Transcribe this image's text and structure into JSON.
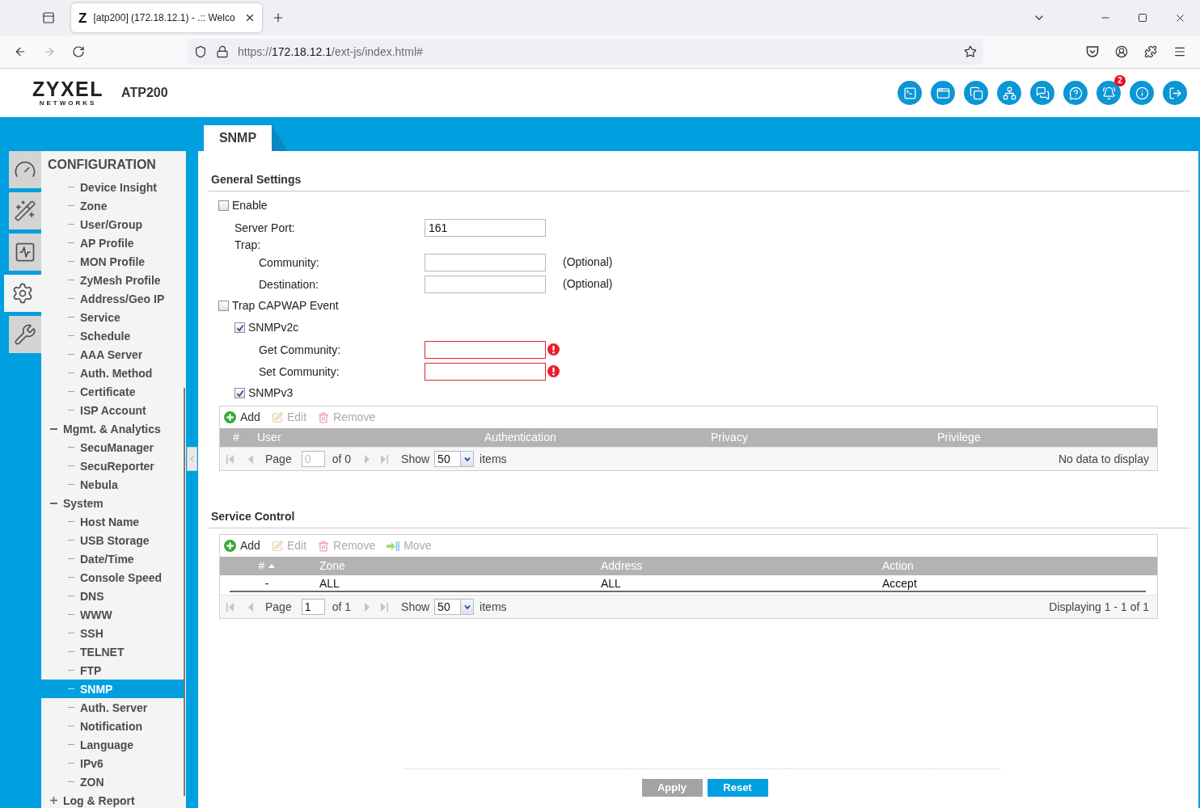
{
  "browser": {
    "tabs": [
      {
        "favicon": "Z",
        "title": "[atp200] (172.18.12.1) - .:: Welco",
        "selected": true
      }
    ],
    "address": {
      "scheme": "https://",
      "host": "172.18.12.1",
      "path": "/ext-js/index.html#"
    }
  },
  "header": {
    "logo": {
      "word": "ZYXEL",
      "tagline": "NETWORKS"
    },
    "product": "ATP200",
    "notification_count": "2"
  },
  "rail_tabs": [
    {
      "selected": false
    },
    {
      "selected": false
    },
    {
      "selected": false
    },
    {
      "selected": true
    },
    {
      "selected": false
    }
  ],
  "sidebar": {
    "title": "CONFIGURATION",
    "items": [
      {
        "children": [
          {
            "label": "Device Insight",
            "selected": false
          },
          {
            "label": "Zone",
            "selected": false
          },
          {
            "label": "User/Group",
            "selected": false
          },
          {
            "label": "AP Profile",
            "selected": false
          },
          {
            "label": "MON Profile",
            "selected": false
          },
          {
            "label": "ZyMesh Profile",
            "selected": false
          },
          {
            "label": "Address/Geo IP",
            "selected": false
          },
          {
            "label": "Service",
            "selected": false
          },
          {
            "label": "Schedule",
            "selected": false
          },
          {
            "label": "AAA Server",
            "selected": false
          },
          {
            "label": "Auth. Method",
            "selected": false
          },
          {
            "label": "Certificate",
            "selected": false
          },
          {
            "label": "ISP Account",
            "selected": false
          }
        ]
      },
      {
        "label": "Mgmt. & Analytics",
        "selected": false,
        "expanded": true,
        "children": [
          {
            "label": "SecuManager",
            "selected": false
          },
          {
            "label": "SecuReporter",
            "selected": false
          },
          {
            "label": "Nebula",
            "selected": false
          }
        ]
      },
      {
        "label": "System",
        "selected": false,
        "expanded": true,
        "children": [
          {
            "label": "Host Name",
            "selected": false
          },
          {
            "label": "USB Storage",
            "selected": false
          },
          {
            "label": "Date/Time",
            "selected": false
          },
          {
            "label": "Console Speed",
            "selected": false
          },
          {
            "label": "DNS",
            "selected": false
          },
          {
            "label": "WWW",
            "selected": false
          },
          {
            "label": "SSH",
            "selected": false
          },
          {
            "label": "TELNET",
            "selected": false
          },
          {
            "label": "FTP",
            "selected": false
          },
          {
            "label": "SNMP",
            "selected": true
          },
          {
            "label": "Auth. Server",
            "selected": false
          },
          {
            "label": "Notification",
            "selected": false
          },
          {
            "label": "Language",
            "selected": false
          },
          {
            "label": "IPv6",
            "selected": false
          },
          {
            "label": "ZON",
            "selected": false
          }
        ]
      },
      {
        "label": "Log & Report",
        "selected": false,
        "expanded": false
      }
    ]
  },
  "content_tabs": [
    {
      "label": "SNMP",
      "selected": true
    }
  ],
  "general_settings": {
    "title": "General Settings",
    "rows": [
      {
        "kind": "checkbox",
        "label": "Enable",
        "checked": false,
        "children": [
          {
            "kind": "field",
            "label": "Server Port:",
            "value": "161",
            "error": false
          },
          {
            "kind": "heading",
            "label": "Trap:",
            "children": [
              {
                "kind": "field",
                "label": "Community:",
                "note": "(Optional)",
                "error": false
              },
              {
                "kind": "field",
                "label": "Destination:",
                "note": "(Optional)",
                "error": false
              }
            ]
          }
        ]
      },
      {
        "kind": "checkbox",
        "label": "Trap CAPWAP Event",
        "checked": false,
        "children": [
          {
            "kind": "checkbox",
            "label": "SNMPv2c",
            "checked": true,
            "children": [
              {
                "kind": "field",
                "label": "Get Community:",
                "error": true
              },
              {
                "kind": "field",
                "label": "Set Community:",
                "error": true
              }
            ]
          },
          {
            "kind": "checkbox",
            "label": "SNMPv3",
            "checked": true
          }
        ]
      }
    ],
    "grid": {
      "toolbar": [
        {
          "kind": "add",
          "label": "Add",
          "disabled": false
        },
        {
          "kind": "edit",
          "label": "Edit",
          "disabled": true
        },
        {
          "kind": "remove",
          "label": "Remove",
          "disabled": true
        }
      ],
      "columns": [
        {
          "label": "#",
          "sorted": false
        },
        {
          "label": "User",
          "sorted": false
        },
        {
          "label": "Authentication",
          "sorted": false
        },
        {
          "label": "Privacy",
          "sorted": false
        },
        {
          "label": "Privilege",
          "sorted": false
        }
      ],
      "paging": {
        "nav_disabled": true,
        "page_label": "Page",
        "page": "0",
        "page_disabled": true,
        "of": "of 0",
        "show_label": "Show",
        "page_size": "50",
        "items_label": "items",
        "status": "No data to display"
      }
    }
  },
  "service_control": {
    "title": "Service Control",
    "grid": {
      "toolbar": [
        {
          "kind": "add",
          "label": "Add",
          "disabled": false
        },
        {
          "kind": "edit",
          "label": "Edit",
          "disabled": true
        },
        {
          "kind": "remove",
          "label": "Remove",
          "disabled": true
        },
        {
          "kind": "move",
          "label": "Move",
          "disabled": true
        }
      ],
      "columns": [
        {
          "label": "#",
          "sorted": true
        },
        {
          "label": "Zone",
          "sorted": false
        },
        {
          "label": "Address",
          "sorted": false
        },
        {
          "label": "Action",
          "sorted": false
        }
      ],
      "rows": [
        {
          "cells": [
            "-",
            "ALL",
            "ALL",
            "Accept"
          ]
        }
      ],
      "paging": {
        "nav_disabled": true,
        "page_label": "Page",
        "page": "1",
        "page_disabled": false,
        "of": "of 1",
        "show_label": "Show",
        "page_size": "50",
        "items_label": "items",
        "status": "Displaying 1 - 1 of 1"
      }
    }
  },
  "footer_buttons": [
    {
      "label": "Apply",
      "disabled": true
    },
    {
      "label": "Reset",
      "disabled": false
    }
  ]
}
